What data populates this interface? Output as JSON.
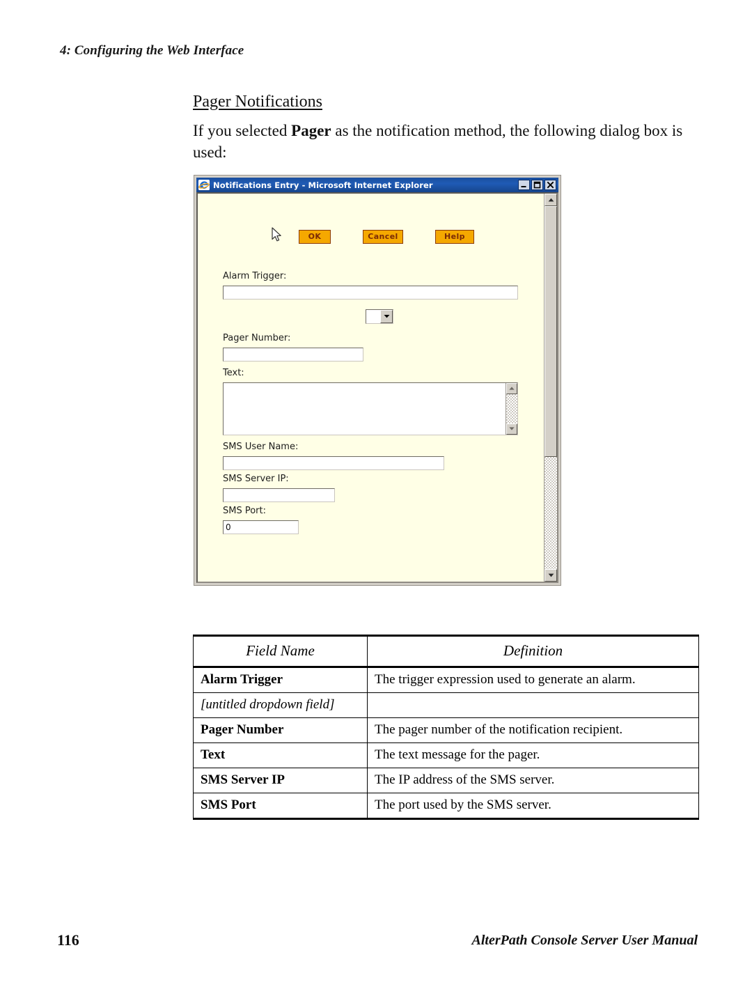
{
  "page": {
    "running_header": "4: Configuring the Web Interface",
    "section_heading": "Pager Notifications",
    "intro_before": "If you selected ",
    "intro_bold": "Pager",
    "intro_after": " as the notification method, the following dialog box is used:",
    "footer_page_number": "116",
    "footer_manual_title": "AlterPath Console Server User Manual"
  },
  "dialog": {
    "title": "Notifications Entry - Microsoft Internet Explorer",
    "icon": "ie-e-icon",
    "window_buttons": {
      "minimize": "minimize-icon",
      "maximize": "maximize-icon",
      "close": "close-icon"
    },
    "buttons": {
      "ok": "OK",
      "cancel": "Cancel",
      "help": "Help"
    },
    "cursor": "mouse-pointer-icon",
    "fields": {
      "alarm_trigger_label": "Alarm Trigger:",
      "alarm_trigger_value": "",
      "dropdown_value": "",
      "pager_number_label": "Pager Number:",
      "pager_number_value": "",
      "text_label": "Text:",
      "text_value": "",
      "sms_user_name_label": "SMS User Name:",
      "sms_user_name_value": "",
      "sms_server_ip_label": "SMS Server IP:",
      "sms_server_ip_value": "",
      "sms_port_label": "SMS Port:",
      "sms_port_value": "0"
    },
    "colors": {
      "titlebar": "#1f5bb5",
      "client_background": "#ffffe6",
      "button_face": "#f5a800",
      "button_border": "#8a3b0b",
      "button_text": "#7a2a06"
    }
  },
  "table": {
    "headers": [
      "Field Name",
      "Definition"
    ],
    "rows": [
      {
        "field": "Alarm Trigger",
        "italic": false,
        "definition": "The trigger expression used to generate an alarm."
      },
      {
        "field": "[untitled dropdown field]",
        "italic": true,
        "definition": ""
      },
      {
        "field": "Pager Number",
        "italic": false,
        "definition": "The pager number of the notification recipient."
      },
      {
        "field": "Text",
        "italic": false,
        "definition": "The text message for the pager."
      },
      {
        "field": "SMS Server IP",
        "italic": false,
        "definition": "The IP address of the SMS server."
      },
      {
        "field": "SMS Port",
        "italic": false,
        "definition": "The port used by the SMS server."
      }
    ]
  }
}
